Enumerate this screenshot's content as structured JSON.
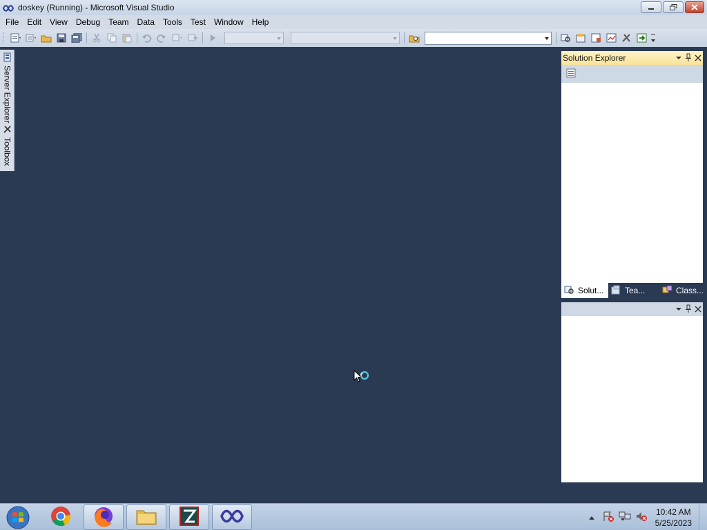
{
  "window": {
    "title": "doskey (Running) - Microsoft Visual Studio",
    "buttons": [
      "minimize-icon",
      "restore-icon",
      "close-icon"
    ]
  },
  "menu": {
    "items": [
      "File",
      "Edit",
      "View",
      "Debug",
      "Team",
      "Data",
      "Tools",
      "Test",
      "Window",
      "Help"
    ]
  },
  "toolbar": {
    "config_combo": "",
    "platform_combo": "",
    "find_box": ""
  },
  "left_tabs": {
    "server_explorer": "Server Explorer",
    "toolbox": "Toolbox"
  },
  "solution_explorer": {
    "title": "Solution Explorer",
    "tabs": [
      {
        "label": "Solut...",
        "icon": "solution-explorer-icon"
      },
      {
        "label": "Tea...",
        "icon": "team-explorer-icon"
      },
      {
        "label": "Class...",
        "icon": "class-view-icon"
      }
    ]
  },
  "properties_panel": {
    "title": ""
  },
  "taskbar": {
    "apps": [
      "chrome-icon",
      "firefox-icon",
      "file-explorer-icon",
      "filezilla-icon",
      "visual-studio-icon"
    ],
    "clock": {
      "time": "10:42 AM",
      "date": "5/25/2023"
    }
  },
  "colors": {
    "workspace": "#2b3a53",
    "active_panel_header": "#f7e39a",
    "chrome": "#cfd8e5"
  }
}
